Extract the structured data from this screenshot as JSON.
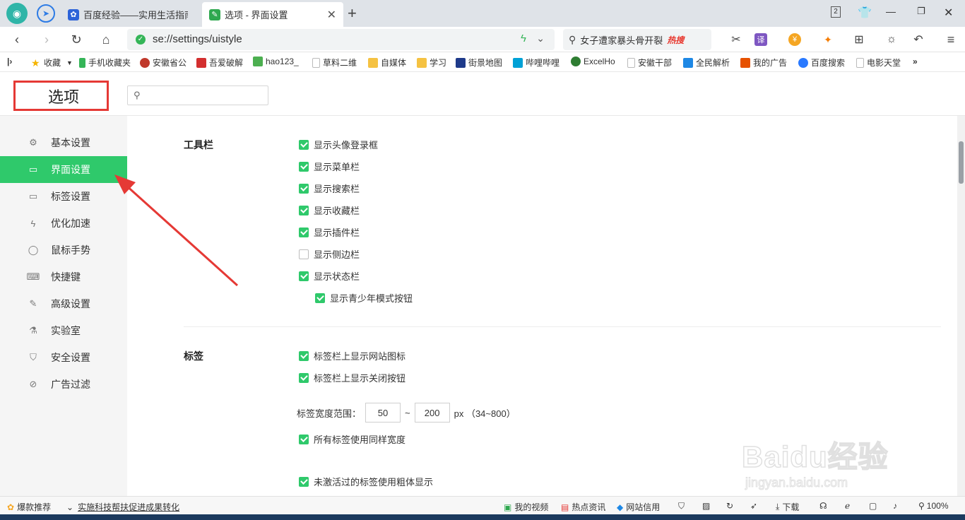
{
  "tabs": [
    {
      "title": "百度经验——实用生活指南",
      "active": false
    },
    {
      "title": "选项 - 界面设置",
      "active": true
    }
  ],
  "tab_count": "2",
  "address": {
    "url": "se://settings/uistyle"
  },
  "search": {
    "text": "女子遭家暴头骨开裂",
    "hot": "热搜"
  },
  "bookmarks": [
    {
      "label": "收藏",
      "color": "#f5b400"
    },
    {
      "label": "手机收藏夹",
      "color": "#35b558"
    },
    {
      "label": "安徽省公",
      "color": "#c0392b"
    },
    {
      "label": "吾爱破解",
      "color": "#d32f2f"
    },
    {
      "label": "hao123_",
      "color": "#4caf50"
    },
    {
      "label": "草料二维",
      "color": "#bbbbbb"
    },
    {
      "label": "自媒体",
      "color": "#f5c242"
    },
    {
      "label": "学习",
      "color": "#f5c242"
    },
    {
      "label": "街景地图",
      "color": "#1e3a8a"
    },
    {
      "label": "哔哩哔哩",
      "color": "#00a1d6"
    },
    {
      "label": "ExcelHo",
      "color": "#2e7d32"
    },
    {
      "label": "安徽干部",
      "color": "#bbbbbb"
    },
    {
      "label": "全民解析",
      "color": "#1e88e5"
    },
    {
      "label": "我的广告",
      "color": "#e65100"
    },
    {
      "label": "百度搜索",
      "color": "#2979ff"
    },
    {
      "label": "电影天堂",
      "color": "#bbbbbb"
    }
  ],
  "page": {
    "title": "选项"
  },
  "sidebar": [
    {
      "label": "基本设置",
      "icon": "gear-icon",
      "glyph": "⚙"
    },
    {
      "label": "界面设置",
      "icon": "window-icon",
      "glyph": "▭"
    },
    {
      "label": "标签设置",
      "icon": "tab-icon",
      "glyph": "▭"
    },
    {
      "label": "优化加速",
      "icon": "lightning-icon",
      "glyph": "ϟ"
    },
    {
      "label": "鼠标手势",
      "icon": "mouse-icon",
      "glyph": "◯"
    },
    {
      "label": "快捷键",
      "icon": "keyboard-icon",
      "glyph": "⌨"
    },
    {
      "label": "高级设置",
      "icon": "wrench-icon",
      "glyph": "✎"
    },
    {
      "label": "实验室",
      "icon": "flask-icon",
      "glyph": "⚗"
    },
    {
      "label": "安全设置",
      "icon": "shield-icon",
      "glyph": "⛉"
    },
    {
      "label": "广告过滤",
      "icon": "block-icon",
      "glyph": "⊘"
    }
  ],
  "active_sidebar": "界面设置",
  "sections": {
    "toolbar": {
      "label": "工具栏",
      "options": [
        {
          "label": "显示头像登录框",
          "checked": true
        },
        {
          "label": "显示菜单栏",
          "checked": true
        },
        {
          "label": "显示搜索栏",
          "checked": true
        },
        {
          "label": "显示收藏栏",
          "checked": true
        },
        {
          "label": "显示插件栏",
          "checked": true
        },
        {
          "label": "显示侧边栏",
          "checked": false
        },
        {
          "label": "显示状态栏",
          "checked": true
        }
      ],
      "sub_option": {
        "label": "显示青少年模式按钮",
        "checked": true
      }
    },
    "tabs": {
      "label": "标签",
      "options": [
        {
          "label": "标签栏上显示网站图标",
          "checked": true
        },
        {
          "label": "标签栏上显示关闭按钮",
          "checked": true
        }
      ],
      "width_label": "标签宽度范围：",
      "width_min": "50",
      "width_sep": "~",
      "width_max": "200",
      "width_unit": "px （34~800）",
      "more_options": [
        {
          "label": "所有标签使用同样宽度",
          "checked": true
        },
        {
          "label": "未激活过的标签使用粗体显示",
          "checked": true
        }
      ]
    }
  },
  "statusbar": {
    "left": [
      {
        "label": "爆款推荐"
      },
      {
        "label": "实施科技帮扶促进成果转化"
      }
    ],
    "right": [
      {
        "label": "我的视频"
      },
      {
        "label": "热点资讯"
      },
      {
        "label": "网站信用"
      },
      {
        "label": "下载"
      },
      {
        "label": "100%"
      }
    ]
  },
  "watermark": {
    "brand": "Baidu经验",
    "url": "jingyan.baidu.com"
  },
  "colors": {
    "accent": "#2fc96b",
    "annotation": "#e53935"
  }
}
